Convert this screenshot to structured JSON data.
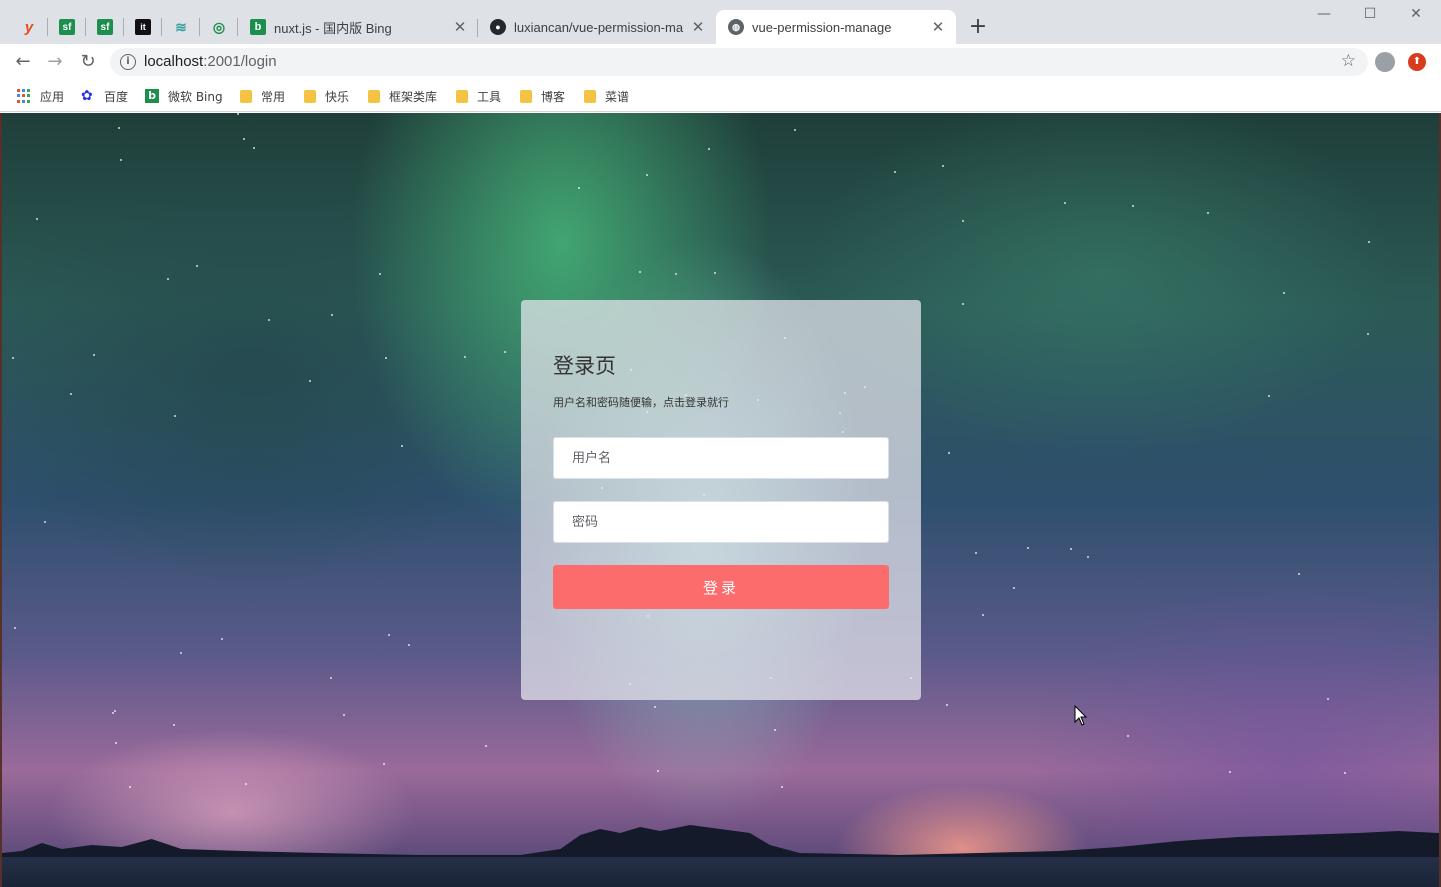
{
  "browser": {
    "pinned_tabs": [
      "y",
      "sf",
      "sf",
      "it",
      "≋",
      "◎"
    ],
    "tabs": [
      {
        "title": "nuxt.js - 国内版 Bing"
      },
      {
        "title": "luxiancan/vue-permission-ma"
      },
      {
        "title": "vue-permission-manage"
      }
    ],
    "new_tab": "+",
    "window_controls": {
      "minimize": "—",
      "maximize": "☐",
      "close": "✕"
    },
    "url_host": "localhost",
    "url_path": ":2001/login",
    "bookmarks": [
      {
        "label": "应用",
        "icon": "apps-icon"
      },
      {
        "label": "百度",
        "icon": "baidu-icon"
      },
      {
        "label": "微软 Bing",
        "icon": "bing-icon"
      },
      {
        "label": "常用",
        "icon": "folder-icon"
      },
      {
        "label": "快乐",
        "icon": "folder-icon"
      },
      {
        "label": "框架类库",
        "icon": "folder-icon"
      },
      {
        "label": "工具",
        "icon": "folder-icon"
      },
      {
        "label": "博客",
        "icon": "folder-icon"
      },
      {
        "label": "菜谱",
        "icon": "folder-icon"
      }
    ]
  },
  "login": {
    "title": "登录页",
    "subtitle": "用户名和密码随便输，点击登录就行",
    "username_placeholder": "用户名",
    "password_placeholder": "密码",
    "submit_label": "登录"
  },
  "colors": {
    "accent": "#fc6c6c",
    "tabstrip": "#dee1e6"
  }
}
